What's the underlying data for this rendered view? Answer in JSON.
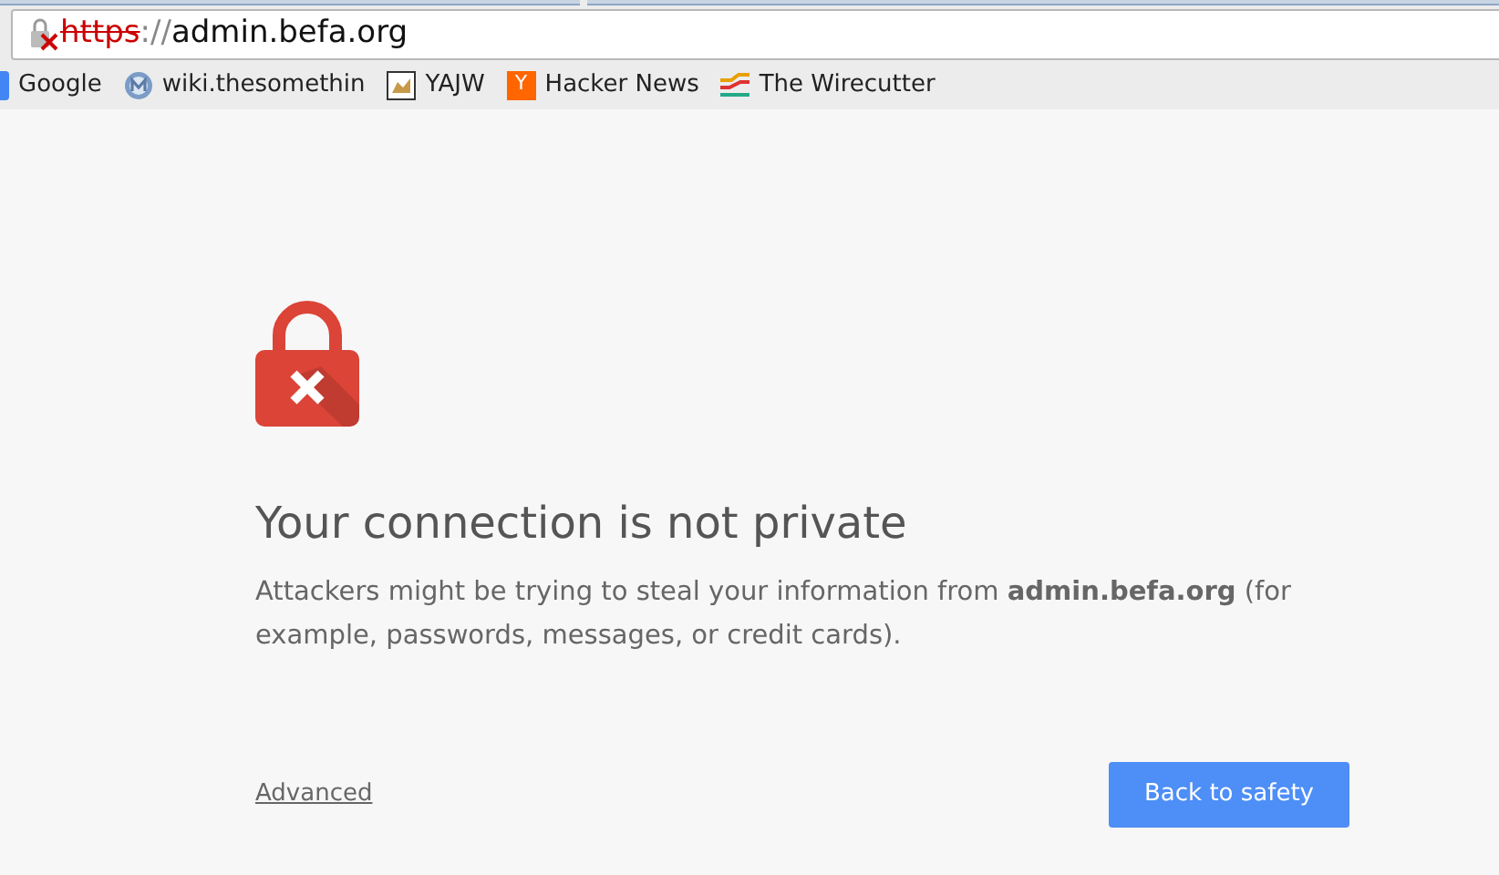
{
  "address_bar": {
    "scheme": "https",
    "separator": "://",
    "host": "admin.befa.org",
    "secure": false
  },
  "bookmarks": [
    {
      "kind": "square",
      "label": "Google"
    },
    {
      "kind": "globe",
      "label": "wiki.thesomethin"
    },
    {
      "kind": "image",
      "label": "YAJW"
    },
    {
      "kind": "letter",
      "icon_text": "Y",
      "label": "Hacker News"
    },
    {
      "kind": "lines",
      "label": "The Wirecutter"
    }
  ],
  "page": {
    "heading": "Your connection is not private",
    "message": "Attackers might be trying to steal your information from **admin.befa.org** (for example, passwords, messages, or credit cards).",
    "advanced_link": "Advanced",
    "back_button": "Back to safety"
  }
}
